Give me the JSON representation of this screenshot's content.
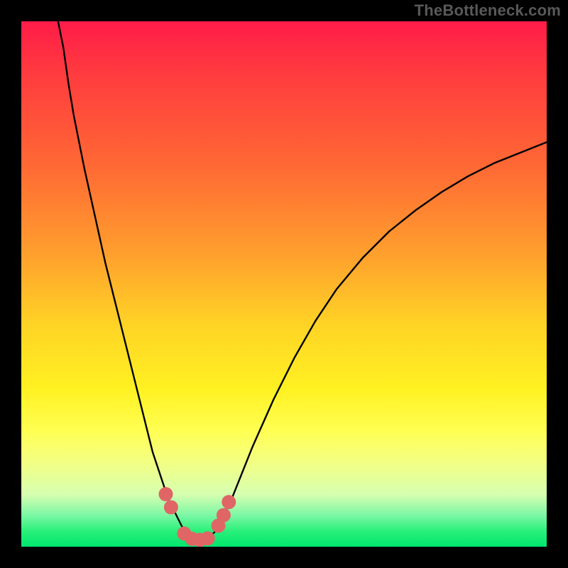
{
  "watermark": "TheBottleneck.com",
  "colors": {
    "page_bg": "#000000",
    "gradient_top": "#ff1c48",
    "gradient_mid": "#fff122",
    "gradient_bottom": "#00e66e",
    "curve_stroke": "#000000",
    "marker_fill": "#e06666"
  },
  "chart_data": {
    "type": "line",
    "title": "",
    "xlabel": "",
    "ylabel": "",
    "xlim": [
      0,
      100
    ],
    "ylim": [
      0,
      100
    ],
    "grid": false,
    "legend": false,
    "note": "Axis values are normalized 0–100; original chart has no tick labels so values are positional estimates.",
    "x": [
      7,
      8,
      9,
      10,
      12,
      14,
      16,
      18,
      20,
      22,
      24,
      25,
      26,
      27,
      28,
      29,
      30,
      31,
      32,
      33,
      34,
      35,
      36,
      37,
      38,
      40,
      42,
      44,
      48,
      52,
      56,
      60,
      65,
      70,
      75,
      80,
      85,
      90,
      95,
      100
    ],
    "values": [
      100,
      95,
      88,
      82,
      72,
      63,
      54,
      46,
      38,
      30,
      22,
      18,
      15,
      12,
      9,
      7,
      5,
      3,
      2,
      1.2,
      1,
      1.2,
      2,
      3,
      5,
      9,
      14,
      19,
      28,
      36,
      43,
      49,
      55,
      60,
      64,
      67.5,
      70.5,
      73,
      75,
      77
    ],
    "markers": {
      "description": "Highlighted points near the curve minimum",
      "points": [
        {
          "x": 27.5,
          "y": 10
        },
        {
          "x": 28.5,
          "y": 7.5
        },
        {
          "x": 31,
          "y": 2.5
        },
        {
          "x": 32.5,
          "y": 1.5
        },
        {
          "x": 34,
          "y": 1.3
        },
        {
          "x": 35.5,
          "y": 1.6
        },
        {
          "x": 37.5,
          "y": 4
        },
        {
          "x": 38.5,
          "y": 6
        },
        {
          "x": 39.5,
          "y": 8.5
        }
      ]
    }
  }
}
